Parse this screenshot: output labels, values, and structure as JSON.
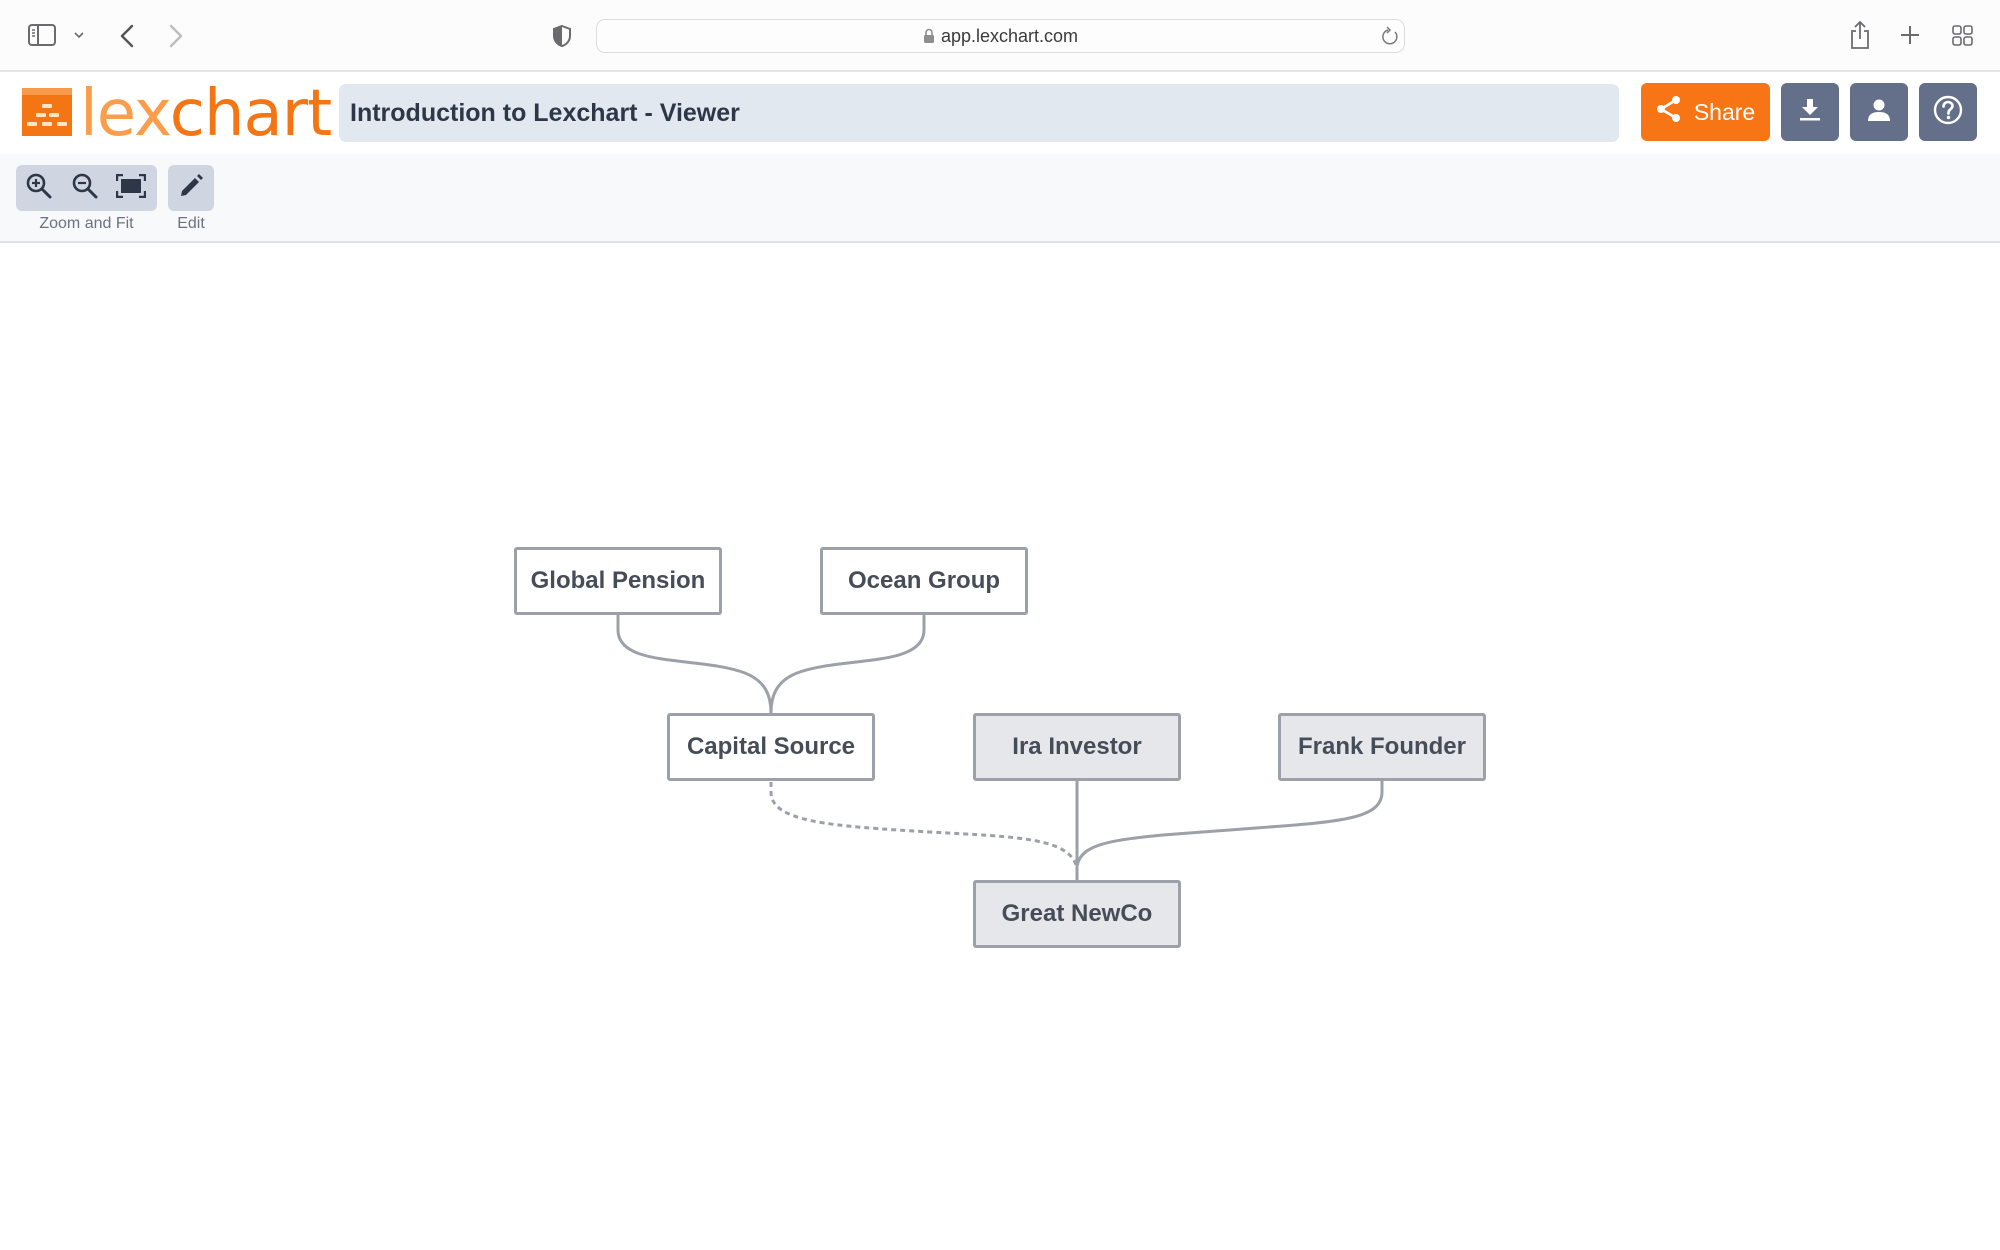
{
  "browser": {
    "url": "app.lexchart.com",
    "icons": [
      "sidebar-icon",
      "chevron-down-icon",
      "back-icon",
      "forward-icon",
      "privacy-shield-icon",
      "lock-icon",
      "reload-icon",
      "share-icon",
      "new-tab-icon",
      "tab-overview-icon"
    ]
  },
  "app": {
    "logo_part1": "lex",
    "logo_part2": "chart",
    "document_title": "Introduction to Lexchart - Viewer",
    "share_label": "Share",
    "buttons": [
      "download-icon",
      "user-icon",
      "help-icon"
    ],
    "colors": {
      "brand_orange": "#f77514",
      "brand_orange_light": "#fb9d4a",
      "button_gray": "#64708a",
      "title_bg": "#e2e8f0"
    }
  },
  "toolbar": {
    "zoom_group_label": "Zoom and Fit",
    "edit_label": "Edit",
    "zoom_tools": [
      "zoom-in-icon",
      "zoom-out-icon",
      "fit-screen-icon"
    ]
  },
  "diagram": {
    "nodes": [
      {
        "id": "global-pension",
        "label": "Global Pension",
        "style": "white"
      },
      {
        "id": "ocean-group",
        "label": "Ocean Group",
        "style": "white"
      },
      {
        "id": "capital-source",
        "label": "Capital Source",
        "style": "white"
      },
      {
        "id": "ira-investor",
        "label": "Ira Investor",
        "style": "gray"
      },
      {
        "id": "frank-founder",
        "label": "Frank Founder",
        "style": "gray"
      },
      {
        "id": "great-newco",
        "label": "Great NewCo",
        "style": "gray"
      }
    ],
    "edges": [
      {
        "from": "global-pension",
        "to": "capital-source",
        "line": "solid"
      },
      {
        "from": "ocean-group",
        "to": "capital-source",
        "line": "solid"
      },
      {
        "from": "capital-source",
        "to": "great-newco",
        "line": "dashed"
      },
      {
        "from": "ira-investor",
        "to": "great-newco",
        "line": "solid"
      },
      {
        "from": "frank-founder",
        "to": "great-newco",
        "line": "solid"
      }
    ]
  }
}
